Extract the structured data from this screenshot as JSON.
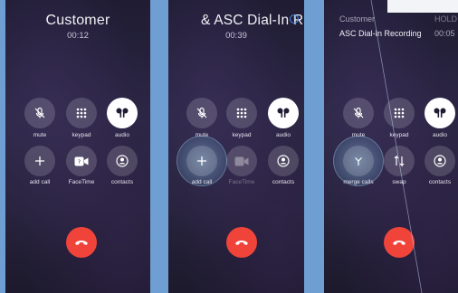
{
  "screens": [
    {
      "title": "Customer",
      "duration": "00:12",
      "buttons": [
        {
          "label": "mute",
          "icon": "mic-off-icon"
        },
        {
          "label": "keypad",
          "icon": "keypad-icon"
        },
        {
          "label": "audio",
          "icon": "airpods-icon",
          "active": true
        },
        {
          "label": "add call",
          "icon": "plus-icon"
        },
        {
          "label": "FaceTime",
          "icon": "facetime-icon"
        },
        {
          "label": "contacts",
          "icon": "contacts-icon"
        }
      ]
    },
    {
      "title": "& ASC Dial-In Re",
      "duration": "00:39",
      "buttons": [
        {
          "label": "mute",
          "icon": "mic-off-icon"
        },
        {
          "label": "keypad",
          "icon": "keypad-icon"
        },
        {
          "label": "audio",
          "icon": "airpods-icon",
          "active": true
        },
        {
          "label": "add call",
          "icon": "plus-icon",
          "highlighted": true
        },
        {
          "label": "FaceTime",
          "icon": "facetime-icon",
          "disabled": true
        },
        {
          "label": "contacts",
          "icon": "contacts-icon"
        }
      ]
    },
    {
      "held_caller": "Customer",
      "held_status": "HOLD",
      "active_caller": "ASC Dial-In Recording",
      "active_duration": "00:05",
      "buttons": [
        {
          "label": "mute",
          "icon": "mic-off-icon"
        },
        {
          "label": "keypad",
          "icon": "keypad-icon"
        },
        {
          "label": "audio",
          "icon": "airpods-icon",
          "active": true
        },
        {
          "label": "merge calls",
          "icon": "merge-icon",
          "highlighted": true
        },
        {
          "label": "swap",
          "icon": "swap-icon"
        },
        {
          "label": "contacts",
          "icon": "contacts-icon"
        }
      ]
    }
  ],
  "colors": {
    "end_call": "#f0443a",
    "info_accent": "#4a8ee8",
    "background": "#6f9fd2"
  }
}
